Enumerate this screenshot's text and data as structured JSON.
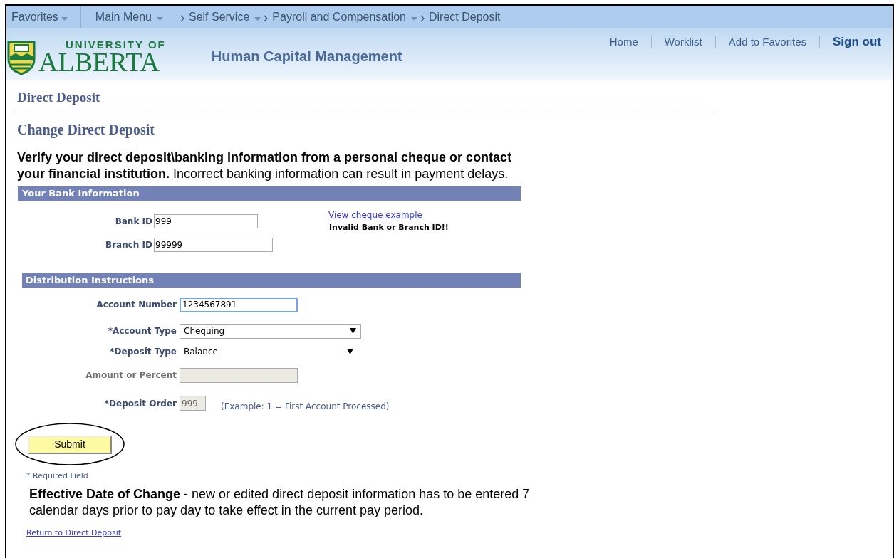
{
  "nav": {
    "favorites": "Favorites",
    "breadcrumbs": [
      {
        "label": "Main Menu",
        "dropdown": true
      },
      {
        "label": "Self Service",
        "dropdown": true
      },
      {
        "label": "Payroll and Compensation",
        "dropdown": true
      },
      {
        "label": "Direct Deposit",
        "dropdown": false
      }
    ]
  },
  "header": {
    "logo_line1": "UNIVERSITY OF",
    "logo_line2": "ALBERTA",
    "app_title": "Human Capital Management",
    "links": [
      {
        "label": "Home",
        "bold": false
      },
      {
        "label": "Worklist",
        "bold": false
      },
      {
        "label": "Add to Favorites",
        "bold": false
      },
      {
        "label": "Sign out",
        "bold": true
      }
    ]
  },
  "page_title": "Direct Deposit",
  "subtitle": "Change Direct Deposit",
  "intro": "**Verify your direct deposit\\banking information from a personal cheque or contact your financial institution.** Incorrect banking information can result in payment delays.",
  "bank_section": {
    "title": "Your Bank Information",
    "fields": [
      {
        "label": "Bank ID",
        "value": "999"
      },
      {
        "label": "Branch ID",
        "value": "99999"
      }
    ],
    "link": "View cheque example",
    "error": "Invalid Bank or Branch ID!!"
  },
  "distribution_section": {
    "title": "Distribution Instructions",
    "fields": [
      {
        "kind": "input",
        "label": "Account Number",
        "value": "1234567891",
        "focused": true,
        "disabled": false
      },
      {
        "kind": "select",
        "label": "*Account Type",
        "value": "Chequing",
        "focused": false,
        "disabled": false
      },
      {
        "kind": "plain_select",
        "label": "*Deposit Type",
        "value": "Balance",
        "focused": false,
        "disabled": false
      },
      {
        "kind": "input",
        "label": "Amount or Percent",
        "focused": false,
        "disabled": true
      },
      {
        "kind": "short_input",
        "label": "*Deposit Order",
        "value": "999",
        "focused": false,
        "disabled": true,
        "hint": "(Example: 1 = First Account Processed)"
      }
    ]
  },
  "submit": "Submit",
  "required_note": "* Required Field",
  "effective_note": "**Effective Date of Change** - new or edited direct deposit information has to be entered 7 calendar days prior to pay day to take effect in the current pay period.",
  "return_link": "Return to Direct Deposit"
}
